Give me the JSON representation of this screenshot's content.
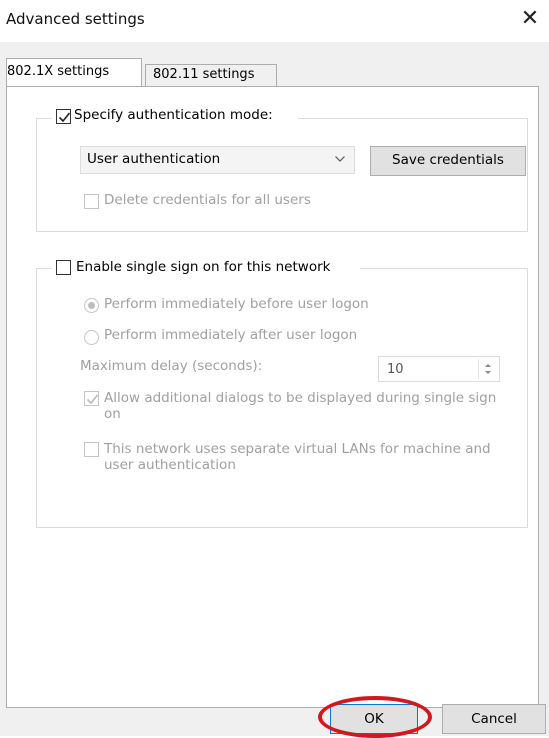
{
  "window": {
    "title": "Advanced settings",
    "close_glyph": "✕"
  },
  "tabs": [
    {
      "label": "802.1X settings",
      "active": true
    },
    {
      "label": "802.11 settings",
      "active": false
    }
  ],
  "auth_group": {
    "checkbox_label": "Specify authentication mode:",
    "checked": true,
    "mode_select_value": "User authentication",
    "save_credentials_label": "Save credentials",
    "delete_credentials_label": "Delete credentials for all users",
    "delete_credentials_checked": false
  },
  "sso_group": {
    "checkbox_label": "Enable single sign on for this network",
    "checked": false,
    "radio_before_label": "Perform immediately before user logon",
    "radio_before_selected": true,
    "radio_after_label": "Perform immediately after user logon",
    "max_delay_label": "Maximum delay (seconds):",
    "max_delay_value": "10",
    "allow_dialogs_label": "Allow additional dialogs to be displayed during single sign on",
    "allow_dialogs_checked": true,
    "separate_vlans_label": "This network uses separate virtual LANs for machine and user authentication",
    "separate_vlans_checked": false
  },
  "footer": {
    "ok_label": "OK",
    "cancel_label": "Cancel"
  },
  "colors": {
    "annotation_circle": "#d0191f",
    "disabled_text": "#a0a0a0"
  }
}
